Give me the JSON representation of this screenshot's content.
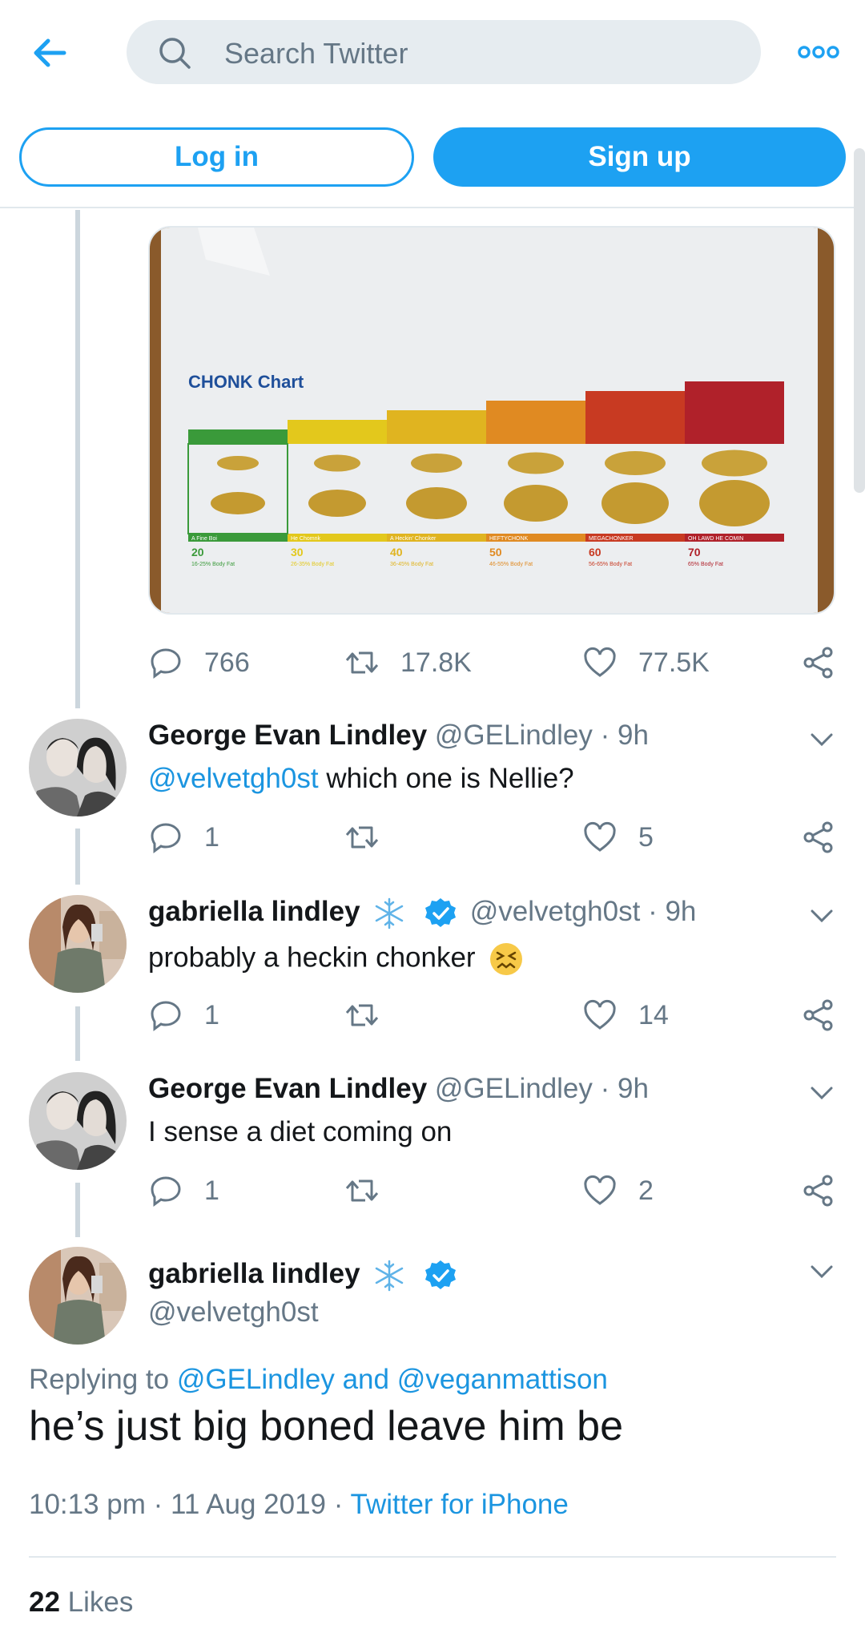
{
  "search": {
    "placeholder": "Search Twitter"
  },
  "auth": {
    "login_label": "Log in",
    "signup_label": "Sign up"
  },
  "media": {
    "chart_title": "CHONK Chart",
    "levels": [
      {
        "label": "A Fine Boi",
        "number": "20",
        "pct": "16-25% Body Fat",
        "color": "#3a9a3a"
      },
      {
        "label": "He Chomnk",
        "number": "30",
        "pct": "26-35% Body Fat",
        "color": "#e3c81c"
      },
      {
        "label": "A Heckin' Chonker",
        "number": "40",
        "pct": "36-45% Body Fat",
        "color": "#e0b420"
      },
      {
        "label": "HEFTYCHONK",
        "number": "50",
        "pct": "46-55% Body Fat",
        "color": "#e08a22"
      },
      {
        "label": "MEGACHONKER",
        "number": "60",
        "pct": "56-65% Body Fat",
        "color": "#c83a22"
      },
      {
        "label": "OH LAWD HE COMIN",
        "number": "70",
        "pct": "65% Body Fat",
        "color": "#b0212a"
      }
    ]
  },
  "parent_stats": {
    "replies": "766",
    "retweets": "17.8K",
    "likes": "77.5K"
  },
  "replies": [
    {
      "name": "George Evan Lindley",
      "handle": "@GELindley",
      "time": "· 9h",
      "mention": "@velvetgh0st",
      "text": " which one is Nellie?",
      "reply_count": "1",
      "retweet_count": "",
      "like_count": "5"
    },
    {
      "name": "gabriella lindley",
      "handle": "@velvetgh0st",
      "time": "· 9h",
      "mention": "",
      "text": "probably a heckin chonker",
      "reply_count": "1",
      "retweet_count": "",
      "like_count": "14"
    },
    {
      "name": "George Evan Lindley",
      "handle": "@GELindley",
      "time": "· 9h",
      "mention": "",
      "text": "I sense a diet coming on",
      "reply_count": "1",
      "retweet_count": "",
      "like_count": "2"
    }
  ],
  "main_tweet": {
    "name": "gabriella lindley",
    "handle": "@velvetgh0st",
    "replying_prefix": "Replying to ",
    "replying_to_1": "@GELindley",
    "replying_and": " and ",
    "replying_to_2": "@veganmattison",
    "text": "he’s just big boned leave him be",
    "time": "10:13 pm · 11 Aug 2019 · ",
    "source": "Twitter for iPhone",
    "likes_count": "22",
    "likes_label": " Likes"
  },
  "colors": {
    "accent": "#1da1f2",
    "link": "#1b95e0",
    "muted": "#657786",
    "verified": "#1da1f2"
  }
}
